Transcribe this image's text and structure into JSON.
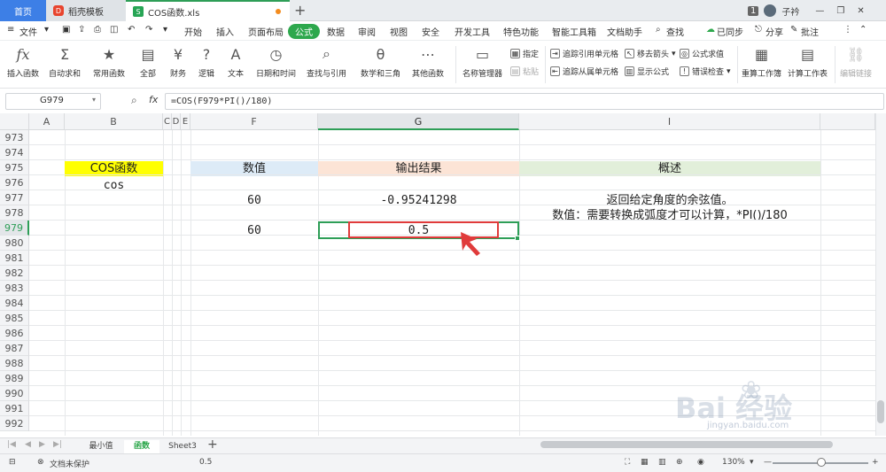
{
  "titlebar": {
    "home": "首页",
    "tab1": "稻壳模板",
    "tab2": "COS函数.xls",
    "badge": "1",
    "user": "子衿"
  },
  "menu": [
    "文件",
    "开始",
    "插入",
    "页面布局",
    "公式",
    "数据",
    "审阅",
    "视图",
    "安全",
    "开发工具",
    "特色功能",
    "智能工具箱",
    "文档助手",
    "查找"
  ],
  "menu_right": {
    "sync": "已同步",
    "share": "分享",
    "annotate": "批注"
  },
  "ribbon": {
    "insert_func": "插入函数",
    "autosum": "自动求和",
    "common": "常用函数",
    "all": "全部",
    "finance": "财务",
    "logic": "逻辑",
    "text": "文本",
    "datetime": "日期和时间",
    "lookup": "查找与引用",
    "math": "数学和三角",
    "other": "其他函数",
    "name_mgr": "名称管理器",
    "specify": "指定",
    "paste": "粘贴",
    "trace_prec": "追踪引用单元格",
    "trace_dep": "追踪从属单元格",
    "remove_arrows": "移去箭头",
    "show_formula": "显示公式",
    "eval": "公式求值",
    "error_check": "错误检查",
    "recalc_book": "重算工作簿",
    "calc_sheet": "计算工作表",
    "edit_links": "编辑链接"
  },
  "formula_bar": {
    "name_box": "G979",
    "fx": "fx",
    "formula": "=COS(F979*PI()/180)"
  },
  "columns": [
    "A",
    "B",
    "C",
    "D",
    "E",
    "F",
    "G",
    "I"
  ],
  "rows": [
    "973",
    "974",
    "975",
    "976",
    "977",
    "978",
    "979",
    "980",
    "981",
    "982",
    "983",
    "984",
    "985",
    "986",
    "987",
    "988",
    "989",
    "990",
    "991",
    "992"
  ],
  "cells": {
    "B975": "COS函数",
    "B976": "cos",
    "F975": "数值",
    "G975": "输出结果",
    "I975": "概述",
    "F977": "60",
    "G977": "-0.95241298",
    "I977": "返回给定角度的余弦值。",
    "I978": "数值：需要转换成弧度才可以计算，*PI()/180",
    "F979": "60",
    "G979": "0.5"
  },
  "sheets": [
    "最小值",
    "函数",
    "Sheet3"
  ],
  "status": {
    "protect": "文档未保护",
    "value": "0.5",
    "zoom": "130%"
  },
  "watermark": {
    "main": "Bai 经验",
    "sub": "jingyan.baidu.com"
  },
  "colors": {
    "accent_green": "#2ea84d",
    "highlight_red": "#e03b3b",
    "yellow": "#ffff00",
    "blue_header": "#ddebf7",
    "orange_header": "#fce4d6",
    "green_header": "#e2efda"
  }
}
